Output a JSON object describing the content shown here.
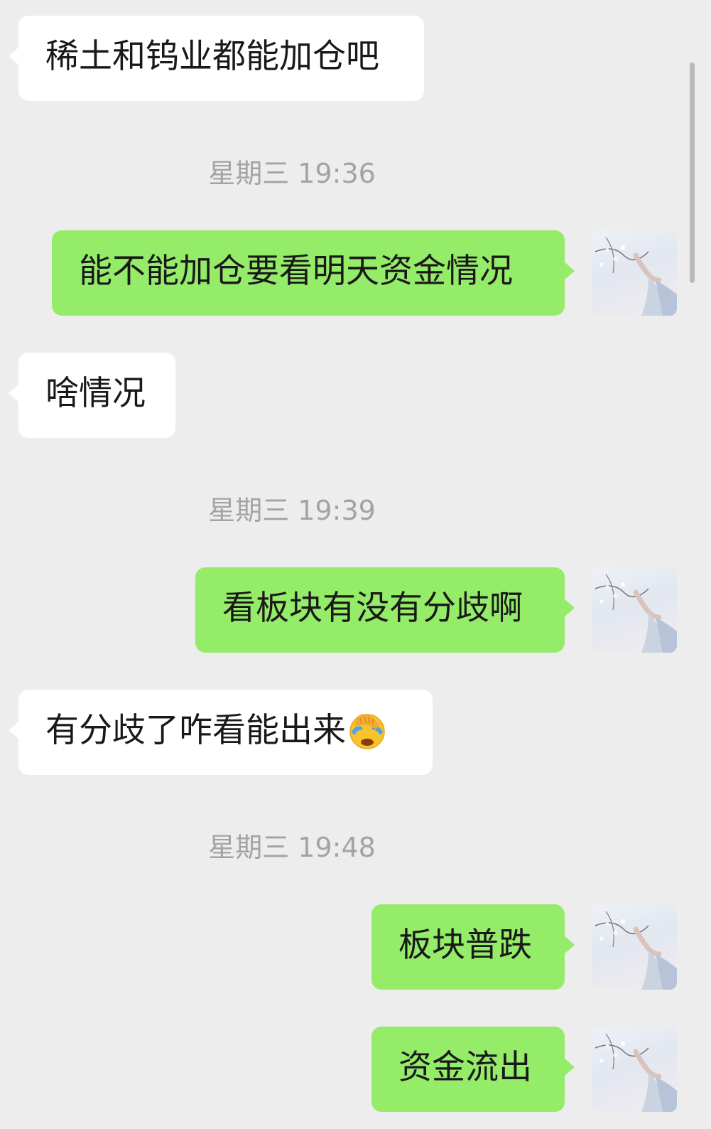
{
  "messages": [
    {
      "type": "incoming",
      "text": "稀土和钨业都能加仓吧"
    },
    {
      "type": "timestamp",
      "text": "星期三 19:36"
    },
    {
      "type": "outgoing",
      "text": "能不能加仓要看明天资金情况"
    },
    {
      "type": "incoming",
      "text": "啥情况"
    },
    {
      "type": "timestamp",
      "text": "星期三 19:39"
    },
    {
      "type": "outgoing",
      "text": "看板块有没有分歧啊"
    },
    {
      "type": "incoming",
      "text": "有分歧了咋看能出来",
      "emoji": "face-palm-crying-emoji"
    },
    {
      "type": "timestamp",
      "text": "星期三 19:48"
    },
    {
      "type": "outgoing",
      "text": "板块普跌"
    },
    {
      "type": "outgoing",
      "text": "资金流出"
    }
  ],
  "colors": {
    "background": "#ededed",
    "incoming_bubble": "#ffffff",
    "outgoing_bubble": "#95ec69",
    "timestamp_text": "#a3a3a3",
    "message_text": "#191919"
  },
  "icons": {
    "avatar": "user-avatar-icon",
    "emoji": "face-palm-crying-emoji"
  }
}
